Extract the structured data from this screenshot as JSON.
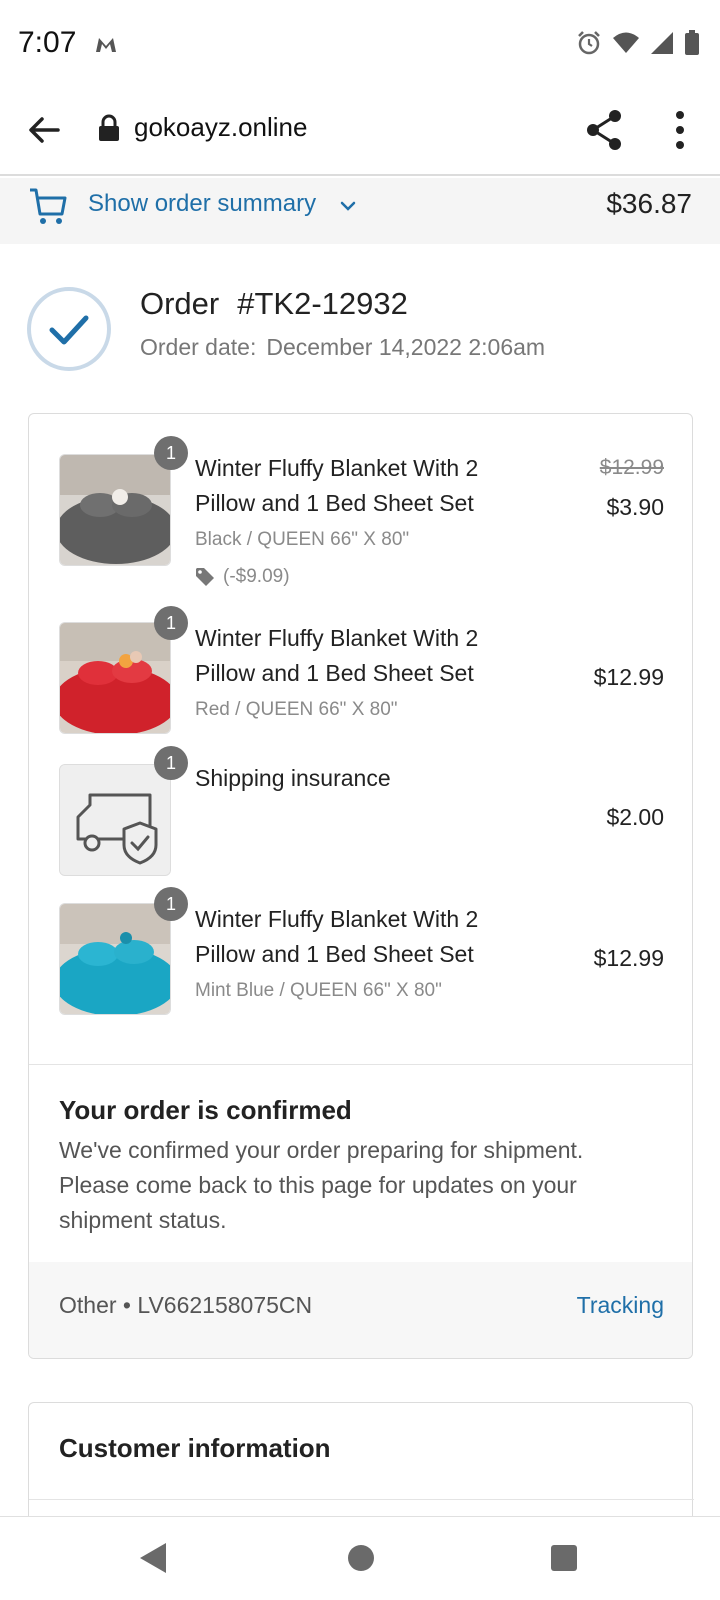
{
  "status_bar": {
    "time": "7:07",
    "icons": [
      "alarm-icon",
      "wifi-icon",
      "signal-icon",
      "battery-icon"
    ]
  },
  "browser": {
    "url": "gokoayz.online",
    "icons": [
      "back-arrow-icon",
      "lock-icon",
      "share-icon",
      "more-vert-icon"
    ]
  },
  "summary_bar": {
    "label": "Show order summary",
    "total": "$36.87"
  },
  "order": {
    "title": "Order",
    "number": "#TK2-12932",
    "date_label": "Order date:",
    "date_value": "December 14,2022 2:06am"
  },
  "items": [
    {
      "qty": "1",
      "name": "Winter Fluffy Blanket With 2 Pillow and 1 Bed Sheet Set",
      "variant": "Black / QUEEN 66\" X 80\"",
      "discount": "(-$9.09)",
      "price_old": "$12.99",
      "price": "$3.90",
      "thumb_color": "#6b6b6b"
    },
    {
      "qty": "1",
      "name": "Winter Fluffy Blanket With 2 Pillow and 1 Bed Sheet Set",
      "variant": "Red / QUEEN 66\" X 80\"",
      "price": "$12.99",
      "thumb_color": "#d0222b"
    },
    {
      "qty": "1",
      "name": "Shipping insurance",
      "price": "$2.00"
    },
    {
      "qty": "1",
      "name": "Winter Fluffy Blanket With 2 Pillow and 1 Bed Sheet Set",
      "variant": "Mint Blue / QUEEN 66\" X 80\"",
      "price": "$12.99",
      "thumb_color": "#1aa6c4"
    }
  ],
  "confirmation": {
    "title": "Your order is confirmed",
    "text": "We've confirmed your order preparing for shipment. Please come back to this page for updates on your shipment status."
  },
  "tracking": {
    "label": "Other • LV662158075CN",
    "link": "Tracking"
  },
  "customer": {
    "title": "Customer information"
  },
  "colors": {
    "accent": "#1f6fa8",
    "badge": "#6f6f6f"
  }
}
